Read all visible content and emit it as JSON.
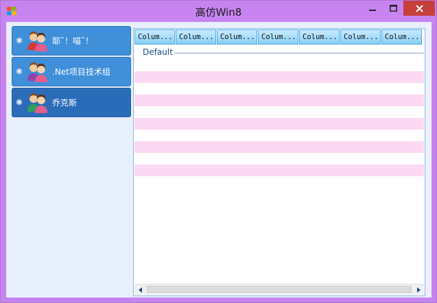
{
  "window": {
    "title": "高仿Win8",
    "icons": {
      "app": "windows-logo-icon",
      "minimize": "minimize-icon",
      "maximize": "maximize-icon",
      "close": "close-icon"
    },
    "colors": {
      "frame": "#c784f0",
      "close_button": "#c6403b",
      "sidebar_item": "#3f8fd9",
      "sidebar_item_active": "#2a6cb8",
      "row_alt": "#fcd9f2",
      "header": "#86d0f8"
    }
  },
  "sidebar": {
    "items": [
      {
        "label": "耶˜！喵˜！",
        "icon": "group-avatar-icon",
        "remove_icon": "close-small-icon"
      },
      {
        "label": ".Net项目技术组",
        "icon": "group-avatar-icon",
        "remove_icon": "close-small-icon"
      },
      {
        "label": "乔克斯",
        "icon": "group-avatar-icon",
        "remove_icon": "close-small-icon",
        "active": true
      }
    ]
  },
  "listview": {
    "columns": [
      "Colum...",
      "Colum...",
      "Colum...",
      "Colum...",
      "Colum...",
      "Colum...",
      "Colum..."
    ],
    "group_label": "Default",
    "scrollbar": {
      "left_icon": "arrow-left-icon",
      "right_icon": "arrow-right-icon"
    }
  }
}
